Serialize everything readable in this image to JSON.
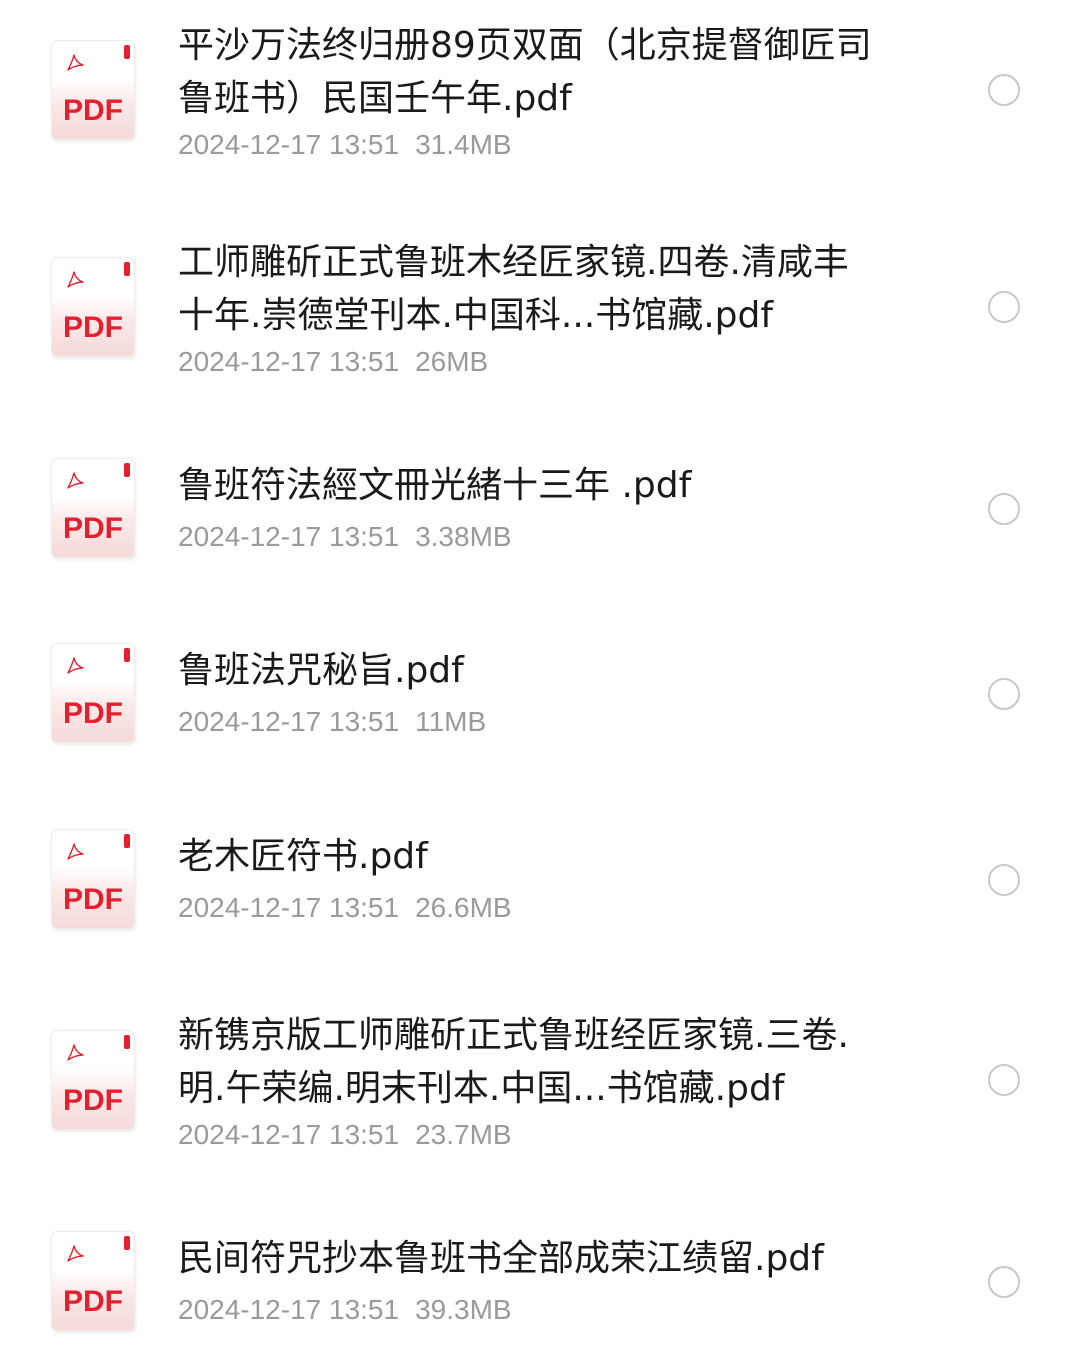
{
  "files": [
    {
      "name": "平沙万法终归册89页双面（北京提督御匠司鲁班书）民国壬午年.pdf",
      "date": "2024-12-17 13:51",
      "size": "31.4MB",
      "type_label": "PDF",
      "icon": "pdf-file-icon",
      "selected": false
    },
    {
      "name": "工师雕斫正式鲁班木经匠家镜.四卷.清咸丰十年.崇德堂刊本.中国科...书馆藏.pdf",
      "date": "2024-12-17 13:51",
      "size": "26MB",
      "type_label": "PDF",
      "icon": "pdf-file-icon",
      "selected": false
    },
    {
      "name": "鲁班符法經文冊光緒十三年 .pdf",
      "date": "2024-12-17 13:51",
      "size": "3.38MB",
      "type_label": "PDF",
      "icon": "pdf-file-icon",
      "selected": false
    },
    {
      "name": "鲁班法咒秘旨.pdf",
      "date": "2024-12-17 13:51",
      "size": "11MB",
      "type_label": "PDF",
      "icon": "pdf-file-icon",
      "selected": false
    },
    {
      "name": "老木匠符书.pdf",
      "date": "2024-12-17 13:51",
      "size": "26.6MB",
      "type_label": "PDF",
      "icon": "pdf-file-icon",
      "selected": false
    },
    {
      "name": "新镌京版工师雕斫正式鲁班经匠家镜.三卷.明.午荣编.明末刊本.中国...书馆藏.pdf",
      "date": "2024-12-17 13:51",
      "size": "23.7MB",
      "type_label": "PDF",
      "icon": "pdf-file-icon",
      "selected": false
    },
    {
      "name": "民间符咒抄本鲁班书全部成荣江绩留.pdf",
      "date": "2024-12-17 13:51",
      "size": "39.3MB",
      "type_label": "PDF",
      "icon": "pdf-file-icon",
      "selected": false
    }
  ],
  "colors": {
    "pdf_red": "#e5202e",
    "title_text": "#1a1a1a",
    "meta_text": "#9a9a9a",
    "radio_border": "#c8c8c8"
  }
}
